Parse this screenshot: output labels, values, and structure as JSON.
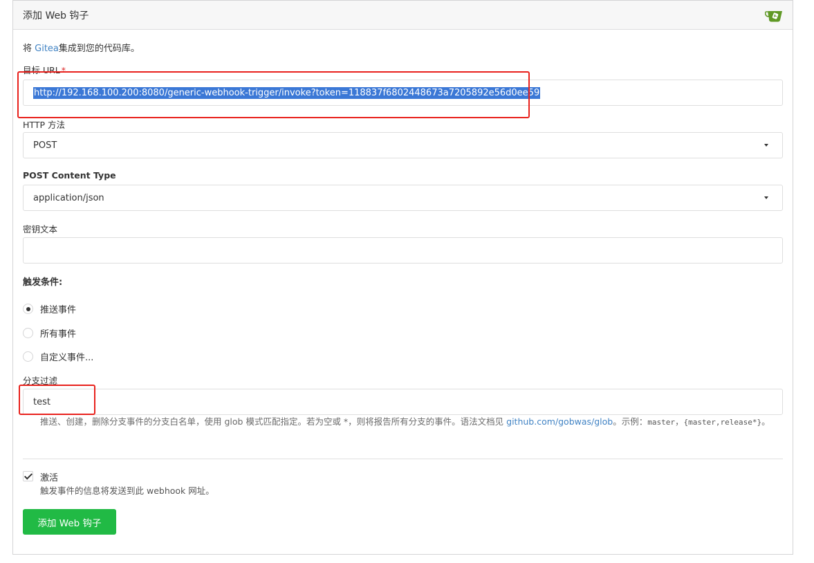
{
  "header": {
    "title": "添加 Web 钩子",
    "logo_icon": "gitea-teacup-icon",
    "logo_color": "#609926"
  },
  "intro": {
    "prefix": "将 ",
    "link": "Gitea",
    "suffix": "集成到您的代码库。"
  },
  "form": {
    "target_url": {
      "label": "目标 URL",
      "required_mark": "*",
      "value": "http://192.168.100.200:8080/generic-webhook-trigger/invoke?token=118837f6802448673a7205892e56d0ee59"
    },
    "http_method": {
      "label": "HTTP 方法",
      "value": "POST"
    },
    "content_type": {
      "label": "POST Content Type",
      "value": "application/json"
    },
    "secret": {
      "label": "密钥文本",
      "value": ""
    },
    "trigger": {
      "label": "触发条件:",
      "options": [
        {
          "label": "推送事件",
          "checked": true
        },
        {
          "label": "所有事件",
          "checked": false
        },
        {
          "label": "自定义事件...",
          "checked": false
        }
      ]
    },
    "branch_filter": {
      "label": "分支过滤",
      "value": "test",
      "help_prefix": "推送、创建，删除分支事件的分支白名单，使用 glob 模式匹配指定。若为空或 *，则将报告所有分支的事件。语法文档见 ",
      "help_link": "github.com/gobwas/glob",
      "help_mid": "。示例：",
      "example1": "master",
      "help_sep": "，",
      "example2": "{master,release*}",
      "help_end": "。"
    },
    "active": {
      "label": "激活",
      "help": "触发事件的信息将发送到此 webhook 网址。",
      "checked": true
    },
    "submit_label": "添加 Web 钩子"
  },
  "colors": {
    "accent_green": "#21ba45",
    "link_blue": "#4183c4",
    "annotation_red": "#e8201b",
    "selection_blue": "#3b78d6"
  }
}
